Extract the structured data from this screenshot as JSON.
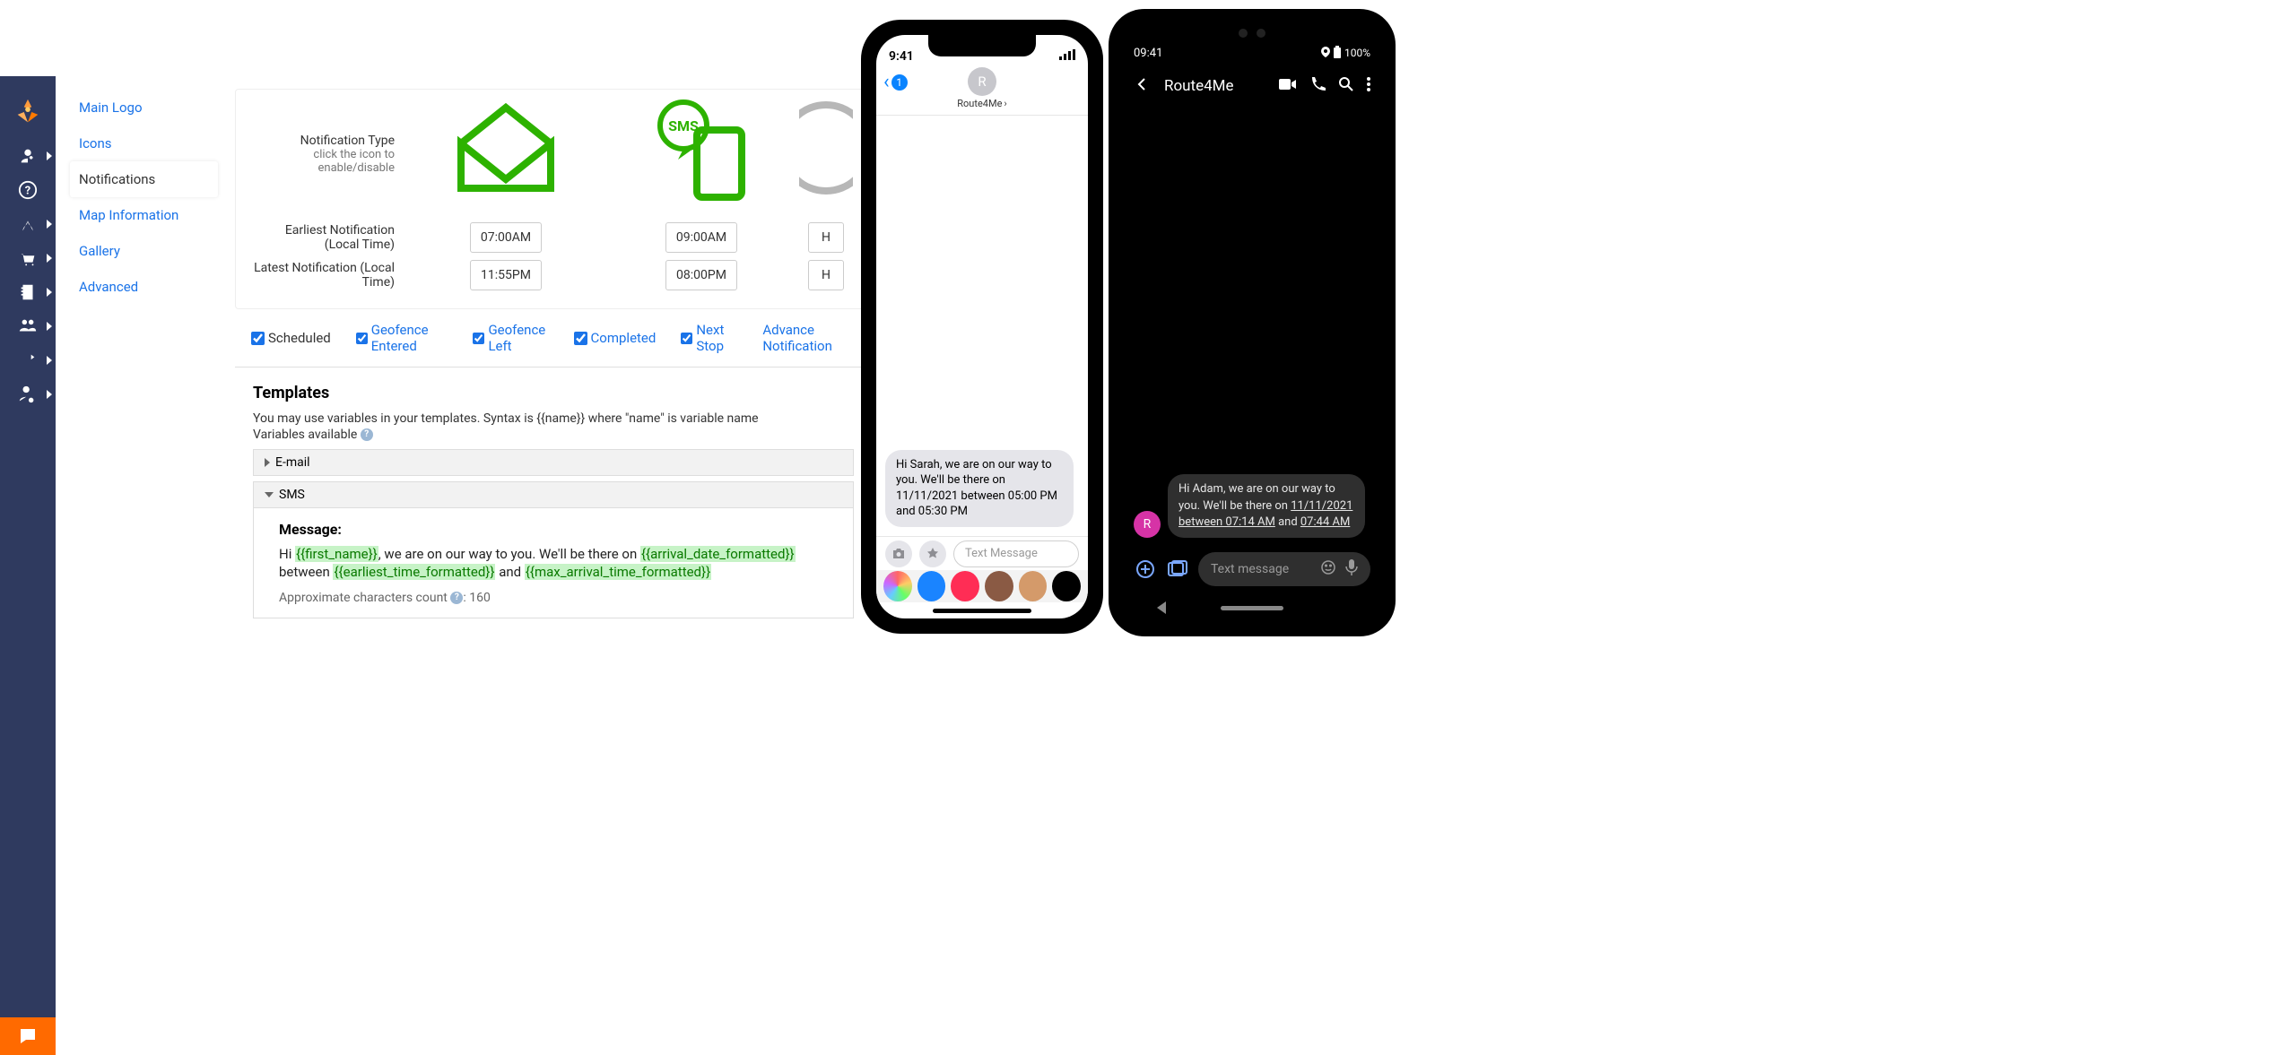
{
  "sidebar": {
    "items": [
      {
        "label": "Main Logo"
      },
      {
        "label": "Icons"
      },
      {
        "label": "Notifications"
      },
      {
        "label": "Map Information"
      },
      {
        "label": "Gallery"
      },
      {
        "label": "Advanced"
      }
    ]
  },
  "notif": {
    "type_label": "Notification Type",
    "type_sub": "click the icon to enable/disable",
    "earliest_label": "Earliest Notification (Local Time)",
    "latest_label": "Latest Notification (Local Time)",
    "email": {
      "earliest": "07:00AM",
      "latest": "11:55PM"
    },
    "sms": {
      "earliest": "09:00AM",
      "latest": "08:00PM"
    },
    "voice": {
      "earliest": "H",
      "latest": "H"
    }
  },
  "tabs": [
    {
      "label": "Scheduled",
      "checked": true,
      "active": true
    },
    {
      "label": "Geofence Entered",
      "checked": true
    },
    {
      "label": "Geofence Left",
      "checked": true
    },
    {
      "label": "Completed",
      "checked": true
    },
    {
      "label": "Next Stop",
      "checked": true
    },
    {
      "label": "Advance Notification",
      "checked": false
    }
  ],
  "templates": {
    "heading": "Templates",
    "hint": "You may use variables in your templates. Syntax is {{name}} where \"name\" is variable name",
    "vars_label": "Variables available",
    "email_header": "E-mail",
    "sms_header": "SMS",
    "message_label": "Message:",
    "msg_p1": "Hi ",
    "msg_v1": "{{first_name}}",
    "msg_p2": ", we are on our way to you. We'll be there on ",
    "msg_v2": "{{arrival_date_formatted}}",
    "msg_p3": " between ",
    "msg_v3": "{{earliest_time_formatted}}",
    "msg_p4": " and ",
    "msg_v4": "{{max_arrival_time_formatted}}",
    "char_label": "Approximate characters count ",
    "char_count": ": 160"
  },
  "iphone": {
    "time": "9:41",
    "back_badge": "1",
    "avatar_initial": "R",
    "contact_name": "Route4Me",
    "bubble": "Hi Sarah, we are on our way to you. We'll be there on 11/11/2021 between 05:00 PM and 05:30 PM",
    "input_placeholder": "Text Message"
  },
  "android": {
    "time": "09:41",
    "battery": "100%",
    "title": "Route4Me",
    "avatar_initial": "R",
    "bubble_p1": "Hi Adam, we are on our way to you. We'll be there on ",
    "bubble_u1": "11/11/2021 between 07:14 AM",
    "bubble_p2": " and ",
    "bubble_u2": "07:44 AM",
    "input_placeholder": "Text message"
  }
}
